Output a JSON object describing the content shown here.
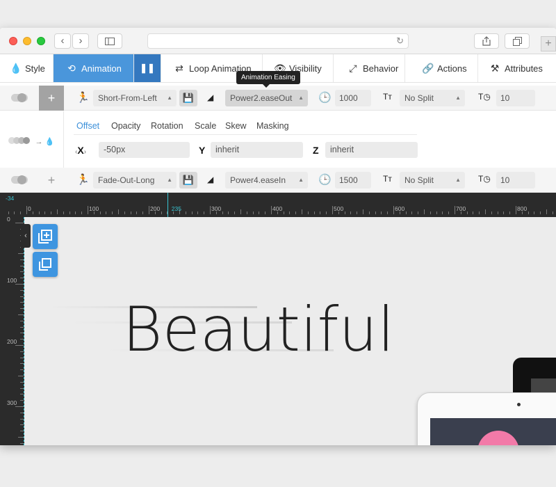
{
  "browser": {
    "back_glyph": "‹",
    "forward_glyph": "›",
    "plus_tab": "+"
  },
  "tabs": [
    {
      "label": "Style",
      "icon": "droplet-icon"
    },
    {
      "label": "Animation",
      "icon": "history-icon"
    },
    {
      "label": "",
      "icon": "pause-icon"
    },
    {
      "label": "Loop Animation",
      "icon": "loop-icon"
    },
    {
      "label": "Visibility",
      "icon": "eye-icon"
    },
    {
      "label": "Behavior",
      "icon": "expand-icon"
    },
    {
      "label": "Actions",
      "icon": "link-icon"
    },
    {
      "label": "Attributes",
      "icon": "tools-icon"
    }
  ],
  "tooltip": "Animation Easing",
  "transition_in": {
    "add_label": "+",
    "animation": "Short-From-Left",
    "easing": "Power2.easeOut",
    "duration": "1000",
    "split": "No Split",
    "delay": "10"
  },
  "properties": {
    "subtabs": [
      "Offset",
      "Opacity",
      "Rotation",
      "Scale",
      "Skew",
      "Masking"
    ],
    "active_subtab": "Offset",
    "x_label": "X",
    "x_value": "-50px",
    "y_label": "Y",
    "y_value": "inherit",
    "z_label": "Z",
    "z_value": "inherit"
  },
  "transition_out": {
    "add_label": "+",
    "animation": "Fade-Out-Long",
    "easing": "Power4.easeIn",
    "duration": "1500",
    "split": "No Split",
    "delay": "10"
  },
  "ruler": {
    "start_label": "-34",
    "labels": [
      "0",
      "100",
      "200",
      "235",
      "300",
      "400",
      "500",
      "600",
      "700",
      "800"
    ],
    "highlight": "235",
    "vertical_labels": [
      "0",
      "100",
      "200",
      "300"
    ]
  },
  "canvas": {
    "headline": "Beautiful",
    "add_layer_icon": "add-layer-icon",
    "duplicate_icon": "duplicate-icon"
  },
  "colors": {
    "accent": "#4a96db",
    "accent_dark": "#3478bf",
    "guide": "#38c5d3"
  }
}
